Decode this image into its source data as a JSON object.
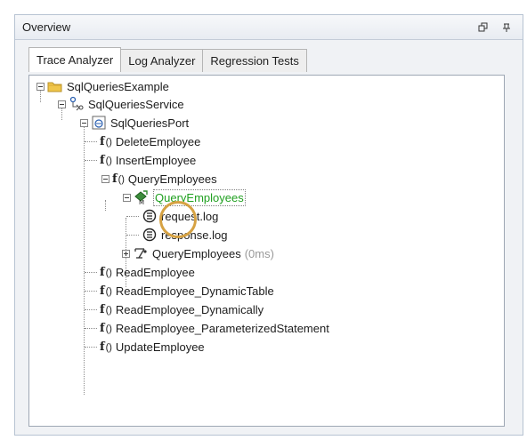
{
  "window": {
    "title": "Overview"
  },
  "tabs": [
    {
      "label": "Trace Analyzer"
    },
    {
      "label": "Log Analyzer"
    },
    {
      "label": "Regression Tests"
    }
  ],
  "tree": {
    "root": "SqlQueriesExample",
    "service": "SqlQueriesService",
    "port": "SqlQueriesPort",
    "operations": [
      "DeleteEmployee",
      "InsertEmployee",
      "QueryEmployees",
      "ReadEmployee",
      "ReadEmployee_DynamicTable",
      "ReadEmployee_Dynamically",
      "ReadEmployee_ParameterizedStatement",
      "UpdateEmployee"
    ],
    "query_node": "QueryEmployees",
    "request_log": "request.log",
    "response_log": "response.log",
    "query_call": "QueryEmployees",
    "query_time": "(0ms)",
    "f_label": "f",
    "paren_label": "()"
  },
  "colors": {
    "highlight": "#20a020",
    "ring": "#d6a243"
  },
  "icons": {
    "folder": "folder-icon",
    "service": "service-icon",
    "port": "port-icon",
    "function": "function-icon",
    "message": "message-icon",
    "log": "log-icon",
    "call": "call-icon"
  }
}
